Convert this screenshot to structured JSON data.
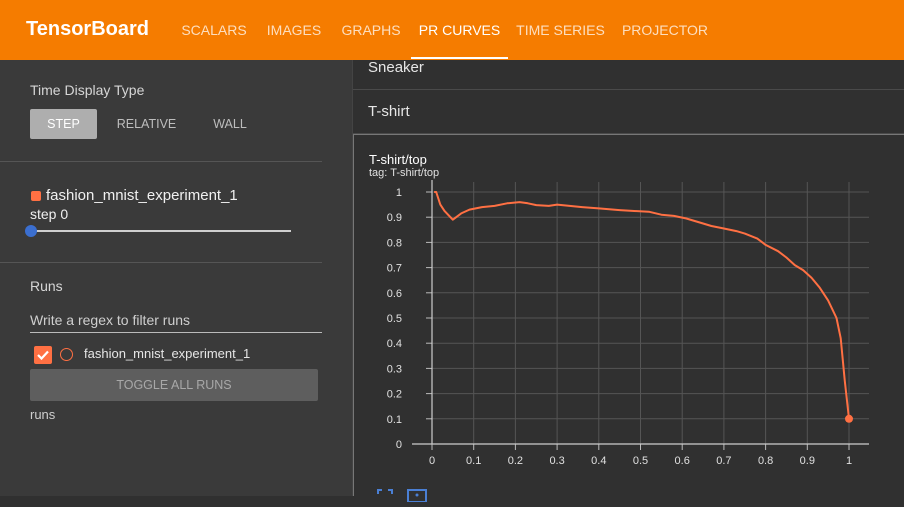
{
  "header": {
    "title": "TensorBoard",
    "tabs": [
      {
        "label": "SCALARS",
        "active": false
      },
      {
        "label": "IMAGES",
        "active": false
      },
      {
        "label": "GRAPHS",
        "active": false
      },
      {
        "label": "PR CURVES",
        "active": true
      },
      {
        "label": "TIME SERIES",
        "active": false
      },
      {
        "label": "PROJECTOR",
        "active": false
      }
    ]
  },
  "sidebar": {
    "time_display_label": "Time Display Type",
    "time_options": [
      "STEP",
      "RELATIVE",
      "WALL"
    ],
    "selected_time_option": "STEP",
    "run_name": "fashion_mnist_experiment_1",
    "run_color": "#ff7043",
    "step_label": "step 0",
    "runs_label": "Runs",
    "filter_placeholder": "Write a regex to filter runs",
    "run_item": "fashion_mnist_experiment_1",
    "toggle_label": "TOGGLE ALL RUNS",
    "footer": "runs"
  },
  "main": {
    "collapsed_sections": [
      "Sneaker",
      "T-shirt"
    ],
    "card": {
      "title": "T-shirt/top",
      "tag": "tag: T-shirt/top"
    }
  },
  "chart_data": {
    "type": "line",
    "title": "",
    "xlabel": "",
    "ylabel": "",
    "xlim": [
      0,
      1
    ],
    "ylim": [
      0,
      1
    ],
    "grid": true,
    "x_ticks": [
      "0",
      "0.1",
      "0.2",
      "0.3",
      "0.4",
      "0.5",
      "0.6",
      "0.7",
      "0.8",
      "0.9",
      "1"
    ],
    "y_ticks": [
      "0",
      "0.1",
      "0.2",
      "0.3",
      "0.4",
      "0.5",
      "0.6",
      "0.7",
      "0.8",
      "0.9",
      "1"
    ],
    "series": [
      {
        "color": "#ff7043",
        "x": [
          0.005,
          0.01,
          0.02,
          0.03,
          0.05,
          0.07,
          0.09,
          0.12,
          0.15,
          0.18,
          0.21,
          0.23,
          0.25,
          0.28,
          0.3,
          0.33,
          0.36,
          0.4,
          0.45,
          0.48,
          0.52,
          0.55,
          0.58,
          0.61,
          0.63,
          0.65,
          0.67,
          0.7,
          0.73,
          0.75,
          0.78,
          0.8,
          0.83,
          0.85,
          0.87,
          0.89,
          0.91,
          0.93,
          0.95,
          0.97,
          0.98,
          0.99,
          1.0
        ],
        "y": [
          1.0,
          1.0,
          0.95,
          0.925,
          0.89,
          0.915,
          0.93,
          0.94,
          0.945,
          0.955,
          0.96,
          0.955,
          0.948,
          0.945,
          0.95,
          0.945,
          0.94,
          0.935,
          0.928,
          0.925,
          0.922,
          0.91,
          0.905,
          0.895,
          0.885,
          0.875,
          0.865,
          0.855,
          0.845,
          0.835,
          0.815,
          0.79,
          0.765,
          0.74,
          0.71,
          0.69,
          0.66,
          0.62,
          0.57,
          0.5,
          0.42,
          0.25,
          0.1
        ]
      }
    ]
  }
}
